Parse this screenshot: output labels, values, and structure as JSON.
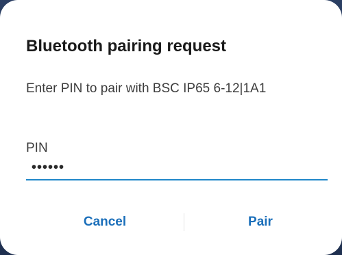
{
  "dialog": {
    "title": "Bluetooth pairing request",
    "message": "Enter PIN to pair with BSC IP65 6-12|1A1",
    "pin_label": "PIN",
    "pin_value": "••••••",
    "cancel_label": "Cancel",
    "pair_label": "Pair"
  },
  "colors": {
    "accent": "#1b6fba",
    "underline": "#1f87c9"
  }
}
